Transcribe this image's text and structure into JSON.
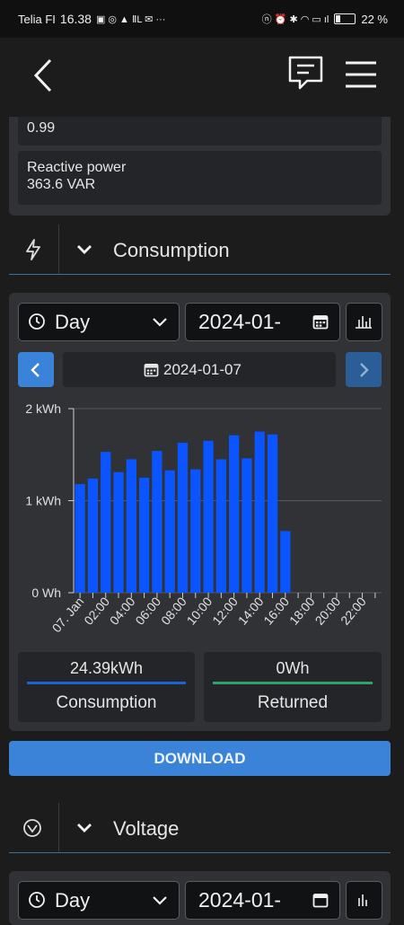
{
  "status_bar": {
    "carrier": "Telia FI",
    "time": "16.38",
    "battery_percent": "22 %"
  },
  "metrics": {
    "power_factor": "0.99",
    "reactive_power_label": "Reactive power",
    "reactive_power_value": "363.6 VAR"
  },
  "consumption_section": {
    "title": "Consumption",
    "period_select": "Day",
    "date_input": "2024-01-",
    "date_nav": "2024-01-07",
    "totals": {
      "consumption_value": "24.39kWh",
      "consumption_label": "Consumption",
      "returned_value": "0Wh",
      "returned_label": "Returned"
    },
    "download_label": "DOWNLOAD"
  },
  "voltage_section": {
    "title": "Voltage",
    "period_select": "Day",
    "date_input": "2024-01-"
  },
  "colors": {
    "bar": "#0a55ff",
    "accent_blue": "#3b82d9",
    "returned_green": "#2ea36a",
    "consumption_line": "#1e63d6"
  },
  "chart_data": {
    "type": "bar",
    "x": [
      "00:00",
      "01:00",
      "02:00",
      "03:00",
      "04:00",
      "05:00",
      "06:00",
      "07:00",
      "08:00",
      "09:00",
      "10:00",
      "11:00",
      "12:00",
      "13:00",
      "14:00",
      "15:00",
      "16:00",
      "17:00",
      "18:00",
      "19:00",
      "20:00",
      "21:00",
      "22:00",
      "23:00"
    ],
    "values": [
      1.18,
      1.24,
      1.53,
      1.31,
      1.45,
      1.25,
      1.54,
      1.33,
      1.63,
      1.34,
      1.65,
      1.45,
      1.71,
      1.46,
      1.75,
      1.72,
      0.67,
      null,
      null,
      null,
      null,
      null,
      null,
      null
    ],
    "ylim": [
      0,
      2
    ],
    "y_ticks": [
      "0 Wh",
      "1 kWh",
      "2 kWh"
    ],
    "x_tick_labels": [
      "07. Jan",
      "02:00",
      "04:00",
      "06:00",
      "08:00",
      "10:00",
      "12:00",
      "14:00",
      "16:00",
      "18:00",
      "20:00",
      "22:00"
    ],
    "grid": true
  }
}
